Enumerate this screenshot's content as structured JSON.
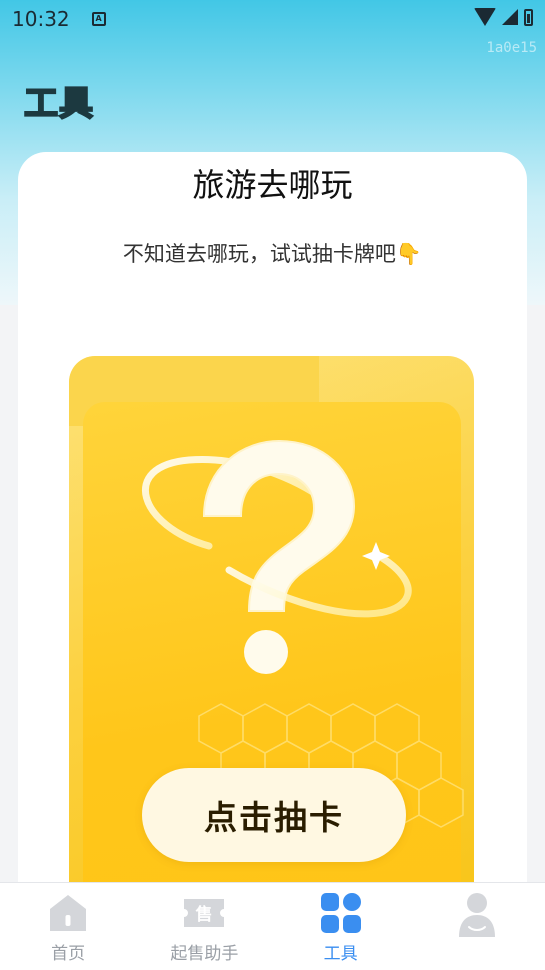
{
  "status_bar": {
    "time": "10:32",
    "notification_icon": "A",
    "watermark": "1a0e15"
  },
  "header": {
    "title": "工具"
  },
  "card": {
    "title": "旅游去哪玩",
    "subtitle": "不知道去哪玩，试试抽卡牌吧👇",
    "button_label": "点击抽卡"
  },
  "bottom_nav": {
    "items": [
      {
        "label": "首页",
        "icon": "home-icon",
        "active": false
      },
      {
        "label": "起售助手",
        "icon": "sale-icon",
        "active": false
      },
      {
        "label": "工具",
        "icon": "tools-grid-icon",
        "active": true
      },
      {
        "label": "",
        "icon": "profile-icon",
        "active": false
      }
    ],
    "sale_icon_char": "售"
  },
  "colors": {
    "accent": "#3a8ef0",
    "card_yellow": "#ffc61a",
    "header_cyan": "#42c7e6"
  }
}
